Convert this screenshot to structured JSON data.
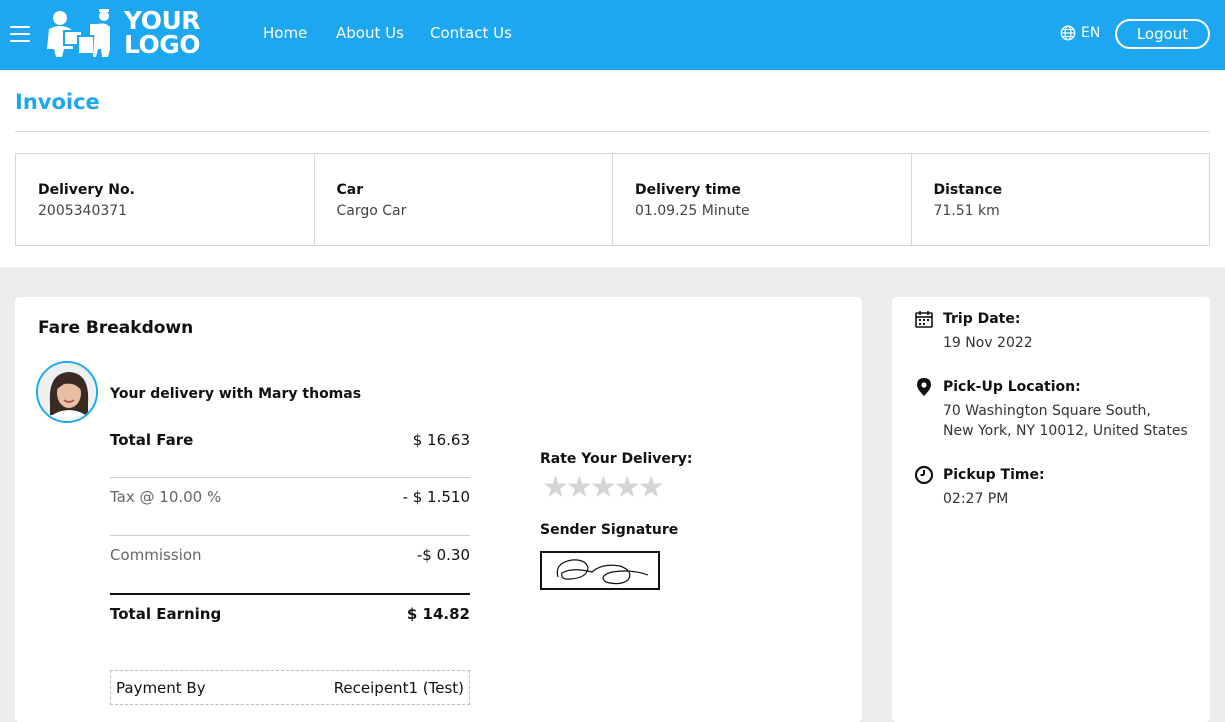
{
  "header": {
    "logo_text_line1": "YOUR",
    "logo_text_line2": "LOGO",
    "nav": [
      "Home",
      "About Us",
      "Contact Us"
    ],
    "language": "EN",
    "logout_label": "Logout"
  },
  "invoice": {
    "title": "Invoice",
    "info": [
      {
        "label": "Delivery No.",
        "value": "2005340371"
      },
      {
        "label": "Car",
        "value": "Cargo Car"
      },
      {
        "label": "Delivery time",
        "value": "01.09.25 Minute"
      },
      {
        "label": "Distance",
        "value": "71.51 km"
      }
    ]
  },
  "fare": {
    "title": "Fare Breakdown",
    "delivery_with": "Your delivery with Mary thomas",
    "rows": [
      {
        "label": "Total Fare",
        "value": "$ 16.63"
      },
      {
        "label": "Tax @ 10.00 %",
        "value": "- $ 1.510"
      },
      {
        "label": "Commission",
        "value": "-$ 0.30"
      },
      {
        "label": "Total Earning",
        "value": "$ 14.82"
      }
    ],
    "payment": {
      "label": "Payment By",
      "value": "Receipent1 (Test)"
    },
    "rate_title": "Rate Your Delivery:",
    "rating_filled": 0,
    "rating_max": 5,
    "signature_title": "Sender Signature"
  },
  "trip": {
    "date_label": "Trip Date:",
    "date_value": "19 Nov 2022",
    "pickup_label": "Pick-Up Location:",
    "pickup_line1": "70 Washington Square South,",
    "pickup_line2": "New York, NY 10012, United States",
    "time_label": "Pickup Time:",
    "time_value": "02:27 PM"
  },
  "colors": {
    "accent": "#1ca7f0",
    "background": "#ececec"
  }
}
